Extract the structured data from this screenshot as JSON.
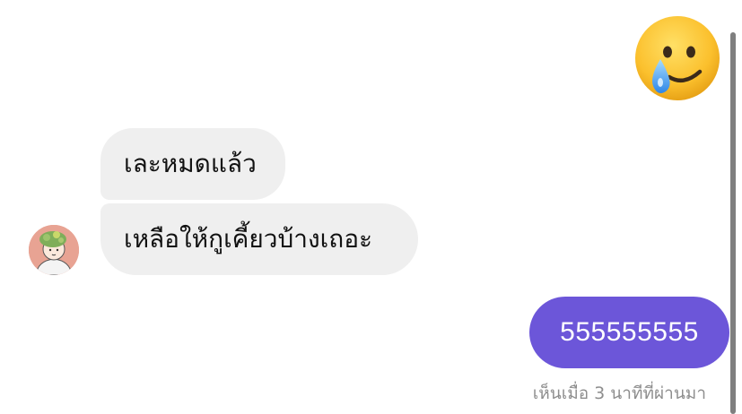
{
  "messages": [
    {
      "type": "emoji",
      "sender": "me",
      "icon": "face-holding-back-tears-emoji"
    },
    {
      "type": "text",
      "sender": "them",
      "text": "เละหมดแล้ว"
    },
    {
      "type": "text",
      "sender": "them",
      "text": "เหลือให้กูเคี้ยวบ้างเถอะ"
    },
    {
      "type": "text",
      "sender": "me",
      "text": "555555555"
    }
  ],
  "seen_status": "เห็นเมื่อ 3 นาทีที่ผ่านมา",
  "colors": {
    "incoming_bubble": "#efefef",
    "outgoing_bubble": "#6c56d9",
    "seen_text": "#8e8e8e",
    "scrollbar": "#7f7f7f"
  }
}
